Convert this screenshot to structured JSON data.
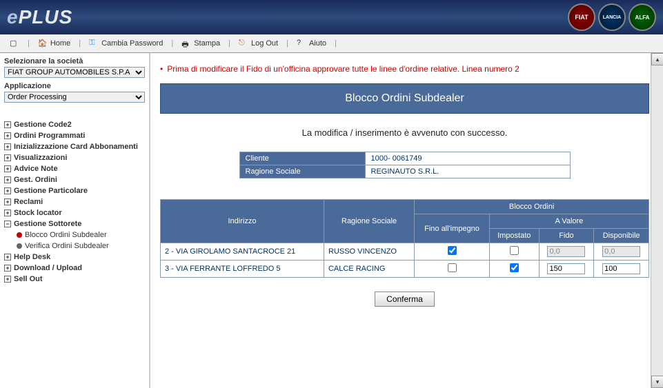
{
  "logo": {
    "e": "e",
    "plus": "PLUS"
  },
  "brands": {
    "fiat": "FIAT",
    "lancia": "LANCIA",
    "alfa": "ALFA"
  },
  "toolbar": {
    "home": "Home",
    "cambiaPwd": "Cambia Password",
    "stampa": "Stampa",
    "logout": "Log Out",
    "aiuto": "Aiuto"
  },
  "sidebar": {
    "societaLabel": "Selezionare la società",
    "societaValue": "FIAT GROUP AUTOMOBILES S.P.A",
    "appLabel": "Applicazione",
    "appValue": "Order Processing",
    "items": [
      "Gestione Code2",
      "Ordini Programmati",
      "Inizializzazione Card Abbonamenti",
      "Visualizzazioni",
      "Advice Note",
      "Gest. Ordini",
      "Gestione Particolare",
      "Reclami",
      "Stock locator",
      "Gestione Sottorete"
    ],
    "sub": {
      "blocco": "Blocco Ordini Subdealer",
      "verifica": "Verifica Ordini Subdealer"
    },
    "items2": [
      "Help Desk",
      "Download / Upload",
      "Sell Out"
    ]
  },
  "alert": "Prima di modificare il Fido di un'officina approvare tutte le linee d'ordine relative. Linea numero 2",
  "pageTitle": "Blocco Ordini Subdealer",
  "success": "La modifica / inserimento è avvenuto con successo.",
  "info": {
    "clienteLabel": "Cliente",
    "clienteValue": "1000- 0061749",
    "ragioneLabel": "Ragione Sociale",
    "ragioneValue": "REGINAUTO S.R.L."
  },
  "table": {
    "headers": {
      "indirizzo": "Indirizzo",
      "ragione": "Ragione Sociale",
      "bloccoOrdini": "Blocco Ordini",
      "finoImpegno": "Fino all'impegno",
      "aValore": "A Valore",
      "impostato": "Impostato",
      "fido": "Fido",
      "disponibile": "Disponibile"
    },
    "rows": [
      {
        "indirizzo": "2 - VIA GIROLAMO SANTACROCE 21",
        "ragione": "RUSSO VINCENZO",
        "finoImpegno": true,
        "impostato": false,
        "fido": "0,0",
        "fidoDisabled": true,
        "disponibile": "0,0",
        "disponibileDisabled": true
      },
      {
        "indirizzo": "3 - VIA FERRANTE LOFFREDO 5",
        "ragione": "CALCE RACING",
        "finoImpegno": false,
        "impostato": true,
        "fido": "150",
        "fidoDisabled": false,
        "disponibile": "100",
        "disponibileDisabled": false
      }
    ]
  },
  "confirm": "Conferma"
}
